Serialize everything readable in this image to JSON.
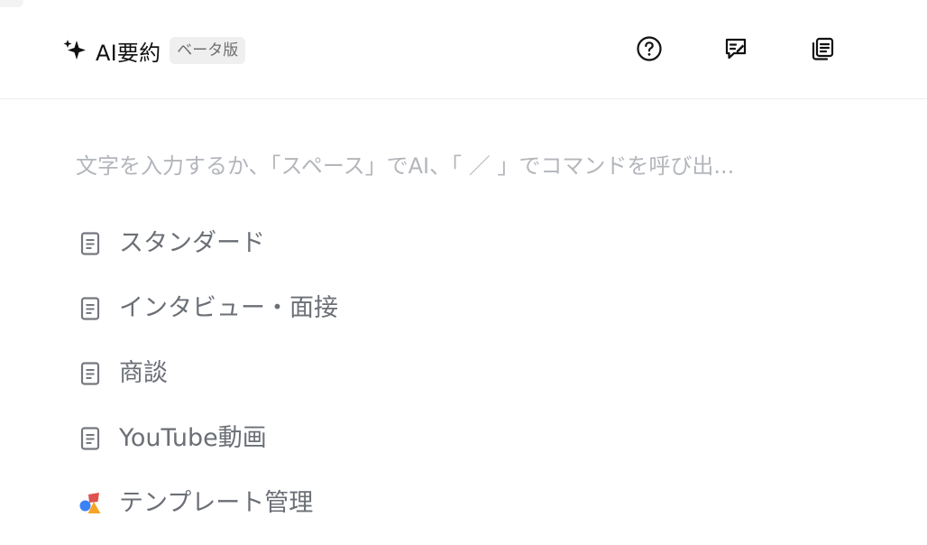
{
  "header": {
    "title": "AI要約",
    "badge": "ベータ版",
    "icons": [
      "help-icon",
      "feedback-icon",
      "copy-icon"
    ]
  },
  "editor": {
    "placeholder": "文字を入力するか、「スペース」でAI、「 ／ 」でコマンドを呼び出..."
  },
  "templates": {
    "items": [
      {
        "label": "スタンダード",
        "icon": "document-icon"
      },
      {
        "label": "インタビュー・面接",
        "icon": "document-icon"
      },
      {
        "label": "商談",
        "icon": "document-icon"
      },
      {
        "label": "YouTube動画",
        "icon": "document-icon"
      },
      {
        "label": "テンプレート管理",
        "icon": "shapes-icon"
      }
    ]
  },
  "colors": {
    "placeholder": "#b3b6bb",
    "menu_text": "#6b6f76",
    "badge_bg": "#efefef"
  }
}
